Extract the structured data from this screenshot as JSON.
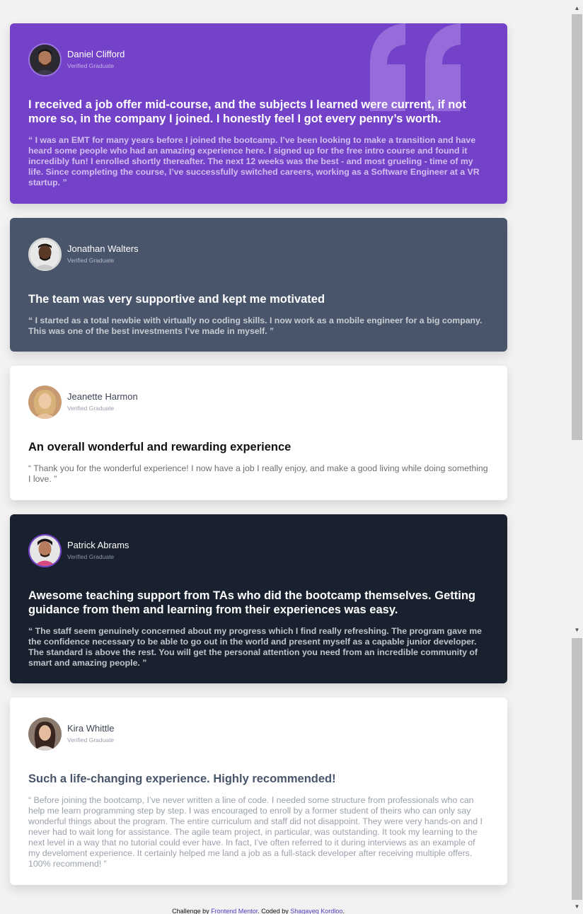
{
  "testimonials": [
    {
      "name": "Daniel Clifford",
      "role": "Verified Graduate",
      "headline": "I received a job offer mid-course, and the subjects I learned were current, if not more so, in the company I joined. I honestly feel I got every penny’s worth.",
      "body": "“ I was an EMT for many years before I joined the bootcamp. I’ve been looking to make a transition and have heard some people who had an amazing experience here. I signed up for the free intro course and found it incredibly fun! I enrolled shortly thereafter. The next 12 weeks was the best - and most grueling - time of my life. Since completing the course, I’ve successfully switched careers, working as a Software Engineer at a VR startup. ”",
      "background": "#7442c8"
    },
    {
      "name": "Jonathan Walters",
      "role": "Verified Graduate",
      "headline": "The team was very supportive and kept me motivated",
      "body": "“ I started as a total newbie with virtually no coding skills. I now work as a mobile engineer for a big company. This was one of the best investments I’ve made in myself. ”",
      "background": "#48556a"
    },
    {
      "name": "Jeanette Harmon",
      "role": "Verified Graduate",
      "headline": "An overall wonderful and rewarding experience",
      "body": "“ Thank you for the wonderful experience! I now have a job I really enjoy, and make a good living while doing something I love. ”",
      "background": "#ffffff"
    },
    {
      "name": "Patrick Abrams",
      "role": "Verified Graduate",
      "headline": "Awesome teaching support from TAs who did the bootcamp themselves. Getting guidance from them and learning from their experiences was easy.",
      "body": "“ The staff seem genuinely concerned about my progress which I find really refreshing. The program gave me the confidence necessary to be able to go out in the world and present myself as a capable junior developer. The standard is above the rest. You will get the personal attention you need from an incredible community of smart and amazing people. ”",
      "background": "#19212e"
    },
    {
      "name": "Kira Whittle",
      "role": "Verified Graduate",
      "headline": "Such a life-changing experience. Highly recommended!",
      "body": "“ Before joining the bootcamp, I’ve never written a line of code. I needed some structure from professionals who can help me learn programming step by step. I was encouraged to enroll by a former student of theirs who can only say wonderful things about the program. The entire curriculum and staff did not disappoint. They were very hands-on and I never had to wait long for assistance. The agile team project, in particular, was outstanding. It took my learning to the next level in a way that no tutorial could ever have. In fact, I’ve often referred to it during interviews as an example of my develoment experience. It certainly helped me land a job as a full-stack developer after receiving multiple offers. 100% recommend! ”",
      "background": "#ffffff"
    }
  ],
  "attribution": {
    "prefix": "Challenge by ",
    "challenge_link": "Frontend Mentor",
    "middle": ". Coded by ",
    "author_link": "Shagayeq Kordloo",
    "suffix": "."
  },
  "icons": {
    "quote": "quotation-mark-icon",
    "scroll_up": "scroll-up-arrow-icon",
    "scroll_down": "scroll-down-arrow-icon"
  },
  "colors": {
    "accent_link": "#4c3fbf",
    "page_background": "#f2f2f2"
  }
}
